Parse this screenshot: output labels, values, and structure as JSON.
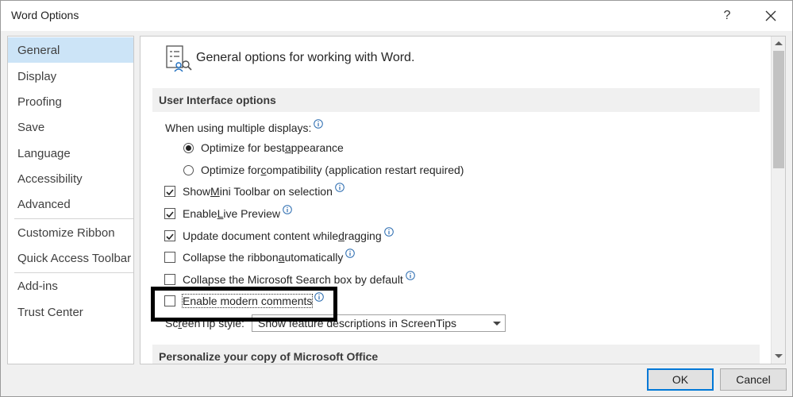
{
  "window": {
    "title": "Word Options",
    "help_label": "?"
  },
  "sidebar": {
    "items": [
      {
        "label": "General"
      },
      {
        "label": "Display"
      },
      {
        "label": "Proofing"
      },
      {
        "label": "Save"
      },
      {
        "label": "Language"
      },
      {
        "label": "Accessibility"
      },
      {
        "label": "Advanced"
      },
      {
        "label": "Customize Ribbon"
      },
      {
        "label": "Quick Access Toolbar"
      },
      {
        "label": "Add-ins"
      },
      {
        "label": "Trust Center"
      }
    ],
    "selected": "General"
  },
  "main": {
    "header": "General options for working with Word.",
    "section_ui": "User Interface options",
    "multiple_displays": {
      "label": "When using multiple displays:",
      "options": [
        {
          "pre": "Optimize for best ",
          "ul": "a",
          "post": "ppearance",
          "selected": true
        },
        {
          "pre": "Optimize for ",
          "ul": "c",
          "post": "ompatibility (application restart required)",
          "selected": false
        }
      ]
    },
    "checkboxes": [
      {
        "pre": "Show ",
        "ul": "M",
        "post": "ini Toolbar on selection",
        "checked": true
      },
      {
        "pre": "Enable ",
        "ul": "L",
        "post": "ive Preview",
        "checked": true
      },
      {
        "pre": "Update document content while ",
        "ul": "d",
        "post": "ragging",
        "checked": true
      },
      {
        "pre": "Collapse the ribbon ",
        "ul": "a",
        "post": "utomatically",
        "checked": false
      },
      {
        "pre": "Collapse the Microsoft Search box by default",
        "ul": "",
        "post": "",
        "checked": false
      },
      {
        "pre": "Enable modern comments",
        "ul": "",
        "post": "",
        "checked": false
      }
    ],
    "screentip": {
      "label_pre": "Sc",
      "label_ul": "r",
      "label_post": "eenTip style:",
      "value": "Show feature descriptions in ScreenTips"
    },
    "section_personalize": "Personalize your copy of Microsoft Office"
  },
  "footer": {
    "ok_label": "OK",
    "cancel_label": "Cancel"
  },
  "colors": {
    "selected_nav": "#cce4f7",
    "accent": "#0078d7",
    "info_icon": "#2b6cb0"
  }
}
